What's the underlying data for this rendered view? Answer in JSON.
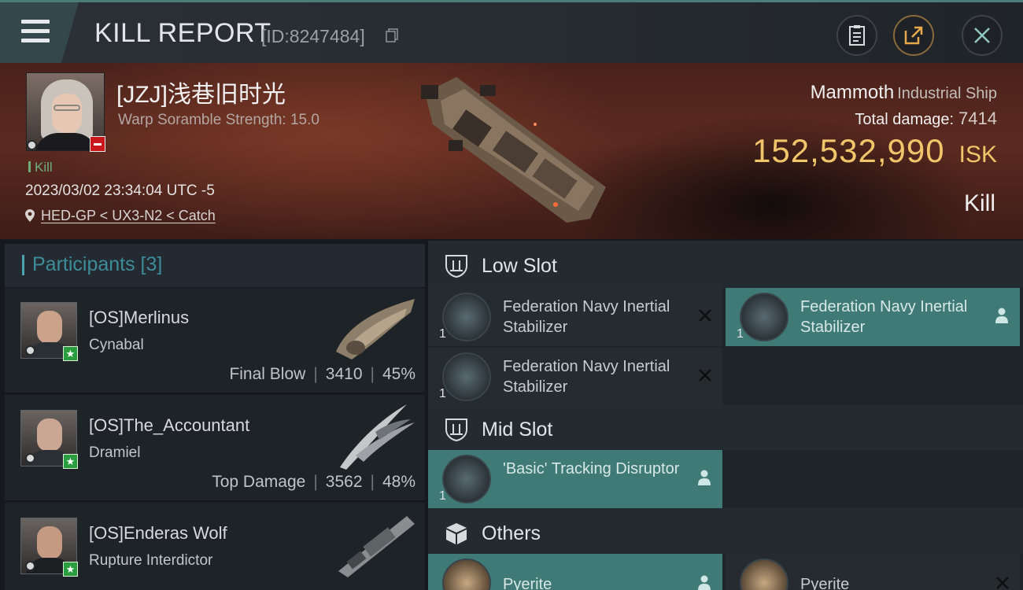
{
  "topbar": {
    "title": "KILL REPORT",
    "report_id": "[ID:8247484]",
    "buttons": [
      "menu",
      "report",
      "share",
      "close"
    ]
  },
  "victim": {
    "name": "[JZJ]浅巷旧时光",
    "warp_strength": "Warp Soramble Strength: 15.0",
    "kill_tag": "Kill",
    "datetime": "2023/03/02 23:34:04 UTC -5",
    "location": "HED-GP < UX3-N2 < Catch",
    "ship_name": "Mammoth",
    "ship_class": "Industrial Ship",
    "total_damage_label": "Total damage:",
    "total_damage": "7414",
    "isk_amount": "152,532,990",
    "isk_currency": "ISK",
    "result": "Kill"
  },
  "participants": {
    "header": "Participants [3]",
    "rows": [
      {
        "name": "[OS]Merlinus",
        "ship": "Cynabal",
        "role": "Final Blow",
        "damage": "3410",
        "percent": "45%"
      },
      {
        "name": "[OS]The_Accountant",
        "ship": "Dramiel",
        "role": "Top Damage",
        "damage": "3562",
        "percent": "48%"
      },
      {
        "name": "[OS]Enderas Wolf",
        "ship": "Rupture Interdictor",
        "role": "",
        "damage": "",
        "percent": ""
      }
    ]
  },
  "fitting": {
    "low_slot": {
      "title": "Low Slot",
      "items": [
        {
          "name": "Federation Navy Inertial Stabilizer",
          "qty": "1",
          "status": "destroyed"
        },
        {
          "name": "Federation Navy Inertial Stabilizer",
          "qty": "1",
          "status": "dropped"
        },
        {
          "name": "Federation Navy Inertial Stabilizer",
          "qty": "1",
          "status": "destroyed"
        }
      ]
    },
    "mid_slot": {
      "title": "Mid Slot",
      "items": [
        {
          "name": "'Basic' Tracking Disruptor",
          "qty": "1",
          "status": "dropped"
        }
      ]
    },
    "others": {
      "title": "Others",
      "items": [
        {
          "name": "Pyerite",
          "status": "dropped"
        },
        {
          "name": "Pyerite",
          "status": "destroyed"
        }
      ]
    }
  },
  "colors": {
    "accent_teal": "#3f7a76",
    "isk_gold": "#f1c66a",
    "kill_green": "#6fae7b",
    "standing_red": "#c8181b",
    "standing_green": "#2a9d3e"
  }
}
